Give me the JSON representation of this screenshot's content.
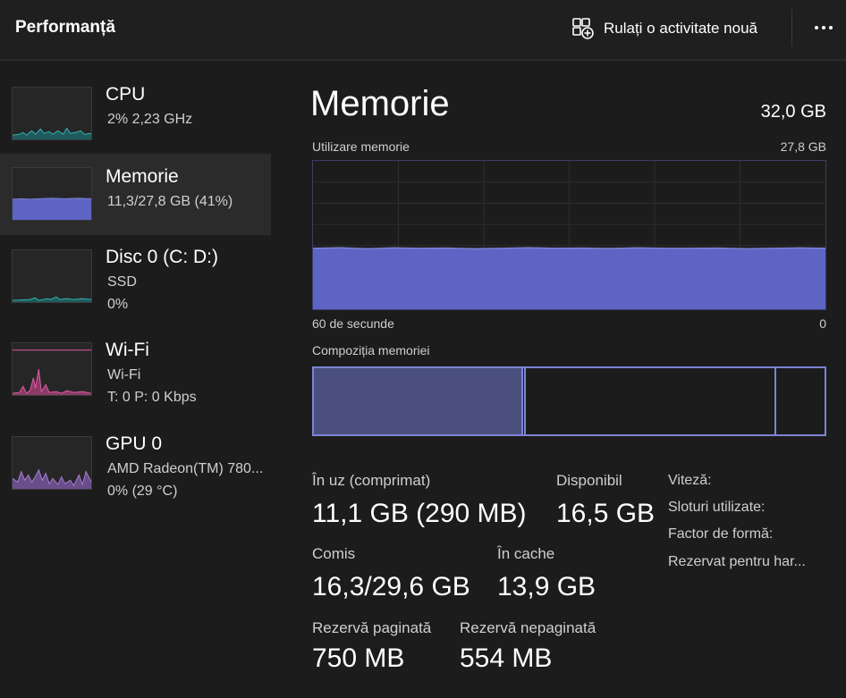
{
  "header": {
    "title": "Performanță",
    "run_task_label": "Rulați o activitate nouă",
    "more_icon": "more-horizontal-icon"
  },
  "sidebar": {
    "items": [
      {
        "name": "CPU",
        "sub1": "2%  2,23 GHz",
        "sub2": "",
        "color": "#2fb4b0",
        "selected": false
      },
      {
        "name": "Memorie",
        "sub1": "11,3/27,8 GB (41%)",
        "sub2": "",
        "color": "#7d84d6",
        "selected": true
      },
      {
        "name": "Disc 0 (C: D:)",
        "sub1": "SSD",
        "sub2": "0%",
        "color": "#2fb4b0",
        "selected": false
      },
      {
        "name": "Wi-Fi",
        "sub1": "Wi-Fi",
        "sub2": "T: 0  P: 0 Kbps",
        "color": "#e05ca4",
        "selected": false
      },
      {
        "name": "GPU 0",
        "sub1": "AMD Radeon(TM) 780...",
        "sub2": "0%  (29 °C)",
        "color": "#a77ed6",
        "selected": false
      }
    ]
  },
  "main": {
    "title": "Memorie",
    "total": "32,0 GB",
    "usage_label": "Utilizare memorie",
    "usage_max": "27,8 GB",
    "time_left": "60 de secunde",
    "time_right": "0",
    "composition_label": "Compoziția memoriei",
    "composition": {
      "in_use_fraction": 0.41,
      "modified_fraction": 0.005,
      "standby_fraction": 0.49,
      "free_fraction": 0.095
    },
    "usage_fraction": 0.41,
    "stats": {
      "in_use_label": "În uz (comprimat)",
      "in_use_value": "11,1 GB (290 MB)",
      "available_label": "Disponibil",
      "available_value": "16,5 GB",
      "committed_label": "Comis",
      "committed_value": "16,3/29,6 GB",
      "cached_label": "În cache",
      "cached_value": "13,9 GB",
      "paged_label": "Rezervă paginată",
      "paged_value": "750 MB",
      "nonpaged_label": "Rezervă nepaginată",
      "nonpaged_value": "554 MB"
    },
    "properties": {
      "speed": "Viteză:",
      "slots": "Sloturi utilizate:",
      "form_factor": "Factor de formă:",
      "reserved": "Rezervat pentru har..."
    },
    "colors": {
      "memory_accent": "#7d84d6",
      "memory_fill": "#5d64c4",
      "background": "#1c1c1c"
    }
  }
}
